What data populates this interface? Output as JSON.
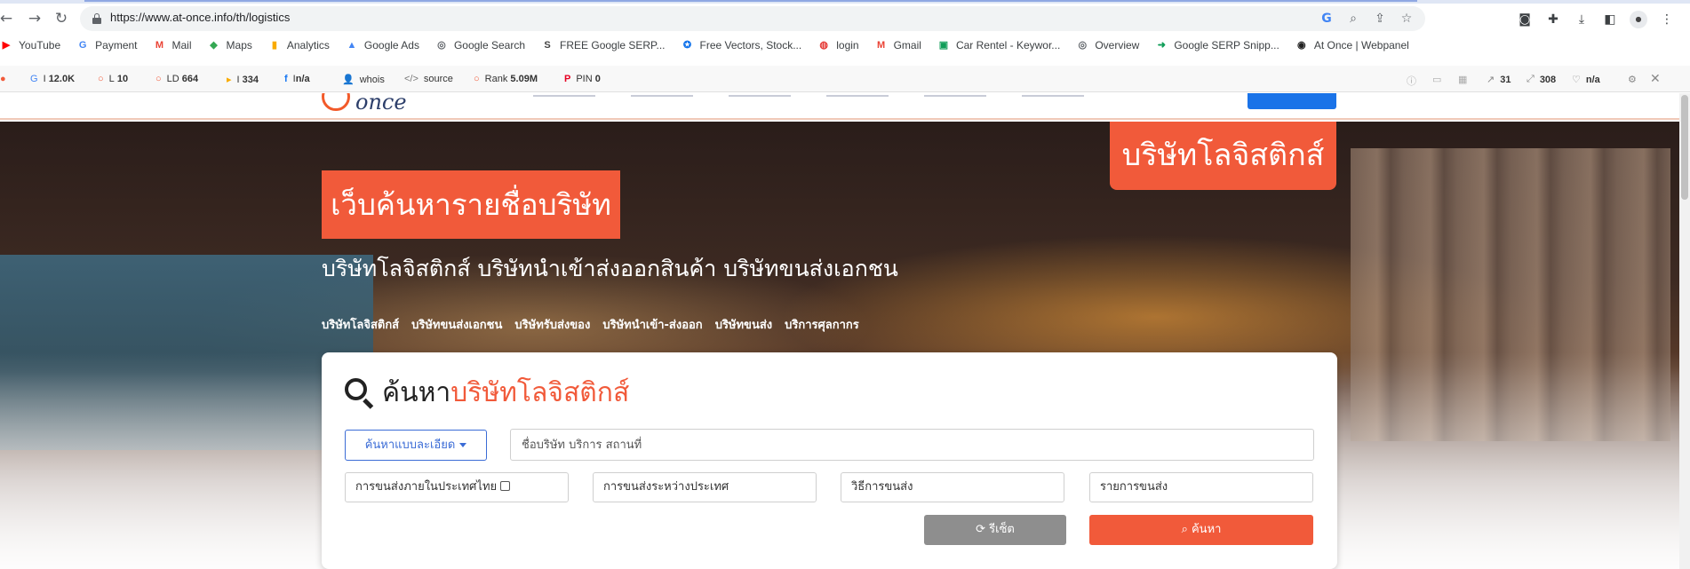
{
  "browser": {
    "url": "https://www.at-once.info/th/logistics",
    "bookmarks": [
      {
        "icon": "youtube-icon",
        "label": "YouTube",
        "color": "#ff0000"
      },
      {
        "icon": "google-icon",
        "label": "Payment",
        "color": "#4285f4"
      },
      {
        "icon": "gmail-icon",
        "label": "Mail",
        "color": "#ea4335"
      },
      {
        "icon": "maps-icon",
        "label": "Maps",
        "color": "#34a853"
      },
      {
        "icon": "analytics-icon",
        "label": "Analytics",
        "color": "#f9ab00"
      },
      {
        "icon": "google-ads-icon",
        "label": "Google Ads",
        "color": "#4285f4"
      },
      {
        "icon": "globe-icon",
        "label": "Google Search",
        "color": "#5f6368"
      },
      {
        "icon": "s-logo-icon",
        "label": "FREE Google SERP...",
        "color": "#444"
      },
      {
        "icon": "freepik-icon",
        "label": "Free Vectors, Stock...",
        "color": "#1273eb"
      },
      {
        "icon": "login-icon",
        "label": "login",
        "color": "#e53935"
      },
      {
        "icon": "gmail-icon",
        "label": "Gmail",
        "color": "#ea4335"
      },
      {
        "icon": "sheet-icon",
        "label": "Car Rentel - Keywor...",
        "color": "#0f9d58"
      },
      {
        "icon": "globe-icon",
        "label": "Overview",
        "color": "#5f6368"
      },
      {
        "icon": "arrow-circle-icon",
        "label": "Google SERP Snipp...",
        "color": "#0f9d58"
      },
      {
        "icon": "atonce-icon",
        "label": "At Once | Webpanel",
        "color": "#222"
      }
    ]
  },
  "seo": {
    "items": [
      {
        "icon": "google-icon",
        "label": "I",
        "value": "12.0K"
      },
      {
        "icon": "circle-icon",
        "label": "L",
        "value": "10"
      },
      {
        "icon": "circle-icon",
        "label": "LD",
        "value": "664"
      },
      {
        "icon": "bing-icon",
        "label": "I",
        "value": "334"
      },
      {
        "icon": "facebook-icon",
        "label": "",
        "value": "n/a"
      },
      {
        "icon": "user-icon",
        "label": "whois",
        "value": ""
      },
      {
        "icon": "code-icon",
        "label": "source",
        "value": ""
      },
      {
        "icon": "circle-icon",
        "label": "Rank",
        "value": "5.09M"
      },
      {
        "icon": "pinterest-icon",
        "label": "PIN",
        "value": "0"
      }
    ],
    "right_a": "31",
    "right_b": "308",
    "right_c": "n/a"
  },
  "site": {
    "logo_text": "once",
    "badge_right": "บริษัทโลจิสติกส์",
    "badge_title": "เว็บค้นหารายชื่อบริษัท",
    "subtitle": "บริษัทโลจิสติกส์ บริษัทนำเข้าส่งออกสินค้า บริษัทขนส่งเอกชน",
    "hero_links": [
      "บริษัทโลจิสติกส์",
      "บริษัทขนส่งเอกชน",
      "บริษัทรับส่งของ",
      "บริษัทนำเข้า-ส่งออก",
      "บริษัทขนส่ง",
      "บริการศุลกากร"
    ]
  },
  "search": {
    "title_prefix": "ค้นหา",
    "title_highlight": "บริษัทโลจิสติกส์",
    "advanced_label": "ค้นหาแบบละเอียด",
    "main_placeholder": "ชื่อบริษัท บริการ สถานที่",
    "filter_domestic": "การขนส่งภายในประเทศไทย",
    "filter_international": "การขนส่งระหว่างประเทศ",
    "filter_method": "วิธีการขนส่ง",
    "filter_items": "รายการขนส่ง",
    "reset_label": "รีเซ็ต",
    "search_label": "ค้นหา"
  },
  "colors": {
    "accent": "#f15a3a",
    "link_blue": "#3b6cd6",
    "reset_gray": "#8e8e8e"
  }
}
